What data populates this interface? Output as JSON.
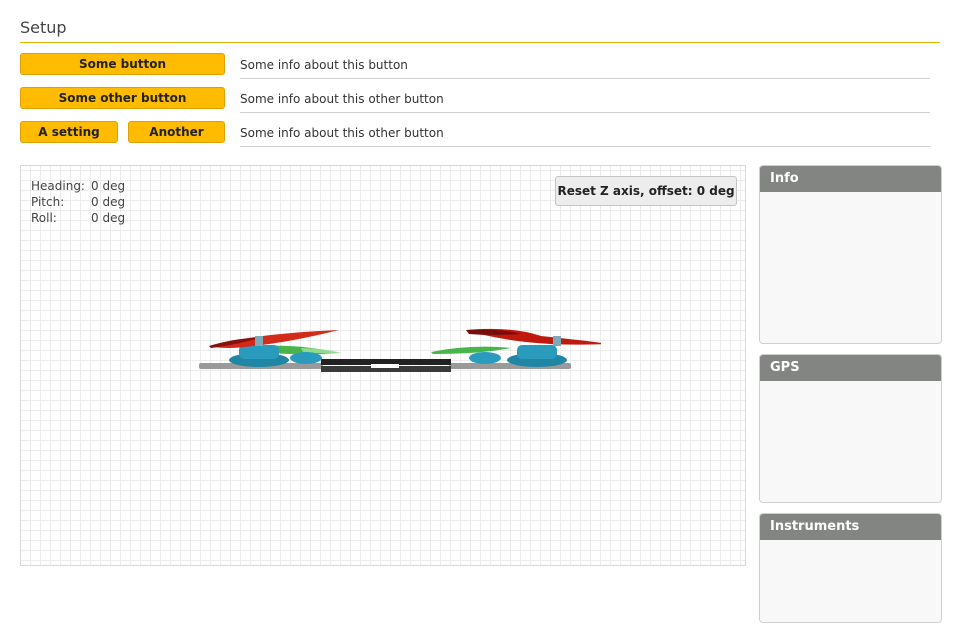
{
  "page": {
    "title": "Setup"
  },
  "setup_rows": [
    {
      "buttons": [
        "Some button"
      ],
      "info": "Some info about this button"
    },
    {
      "buttons": [
        "Some other button"
      ],
      "info": "Some info about this other button"
    },
    {
      "buttons": [
        "A setting",
        "Another"
      ],
      "info": "Some info about this other button"
    }
  ],
  "viewer": {
    "readout": [
      {
        "label": "Heading:",
        "value": "0 deg"
      },
      {
        "label": "Pitch:",
        "value": "0 deg"
      },
      {
        "label": "Roll:",
        "value": "0 deg"
      }
    ],
    "reset_button": "Reset Z axis, offset: 0 deg",
    "model_icon": "quadcopter-model"
  },
  "panels": [
    {
      "title": "Info"
    },
    {
      "title": "GPS"
    },
    {
      "title": "Instruments"
    }
  ],
  "colors": {
    "accent": "#ffbb00",
    "panel_header": "#828582",
    "propeller_red": "#d42a1a",
    "propeller_green": "#2aa82a",
    "motor_blue": "#2a9bbd"
  }
}
